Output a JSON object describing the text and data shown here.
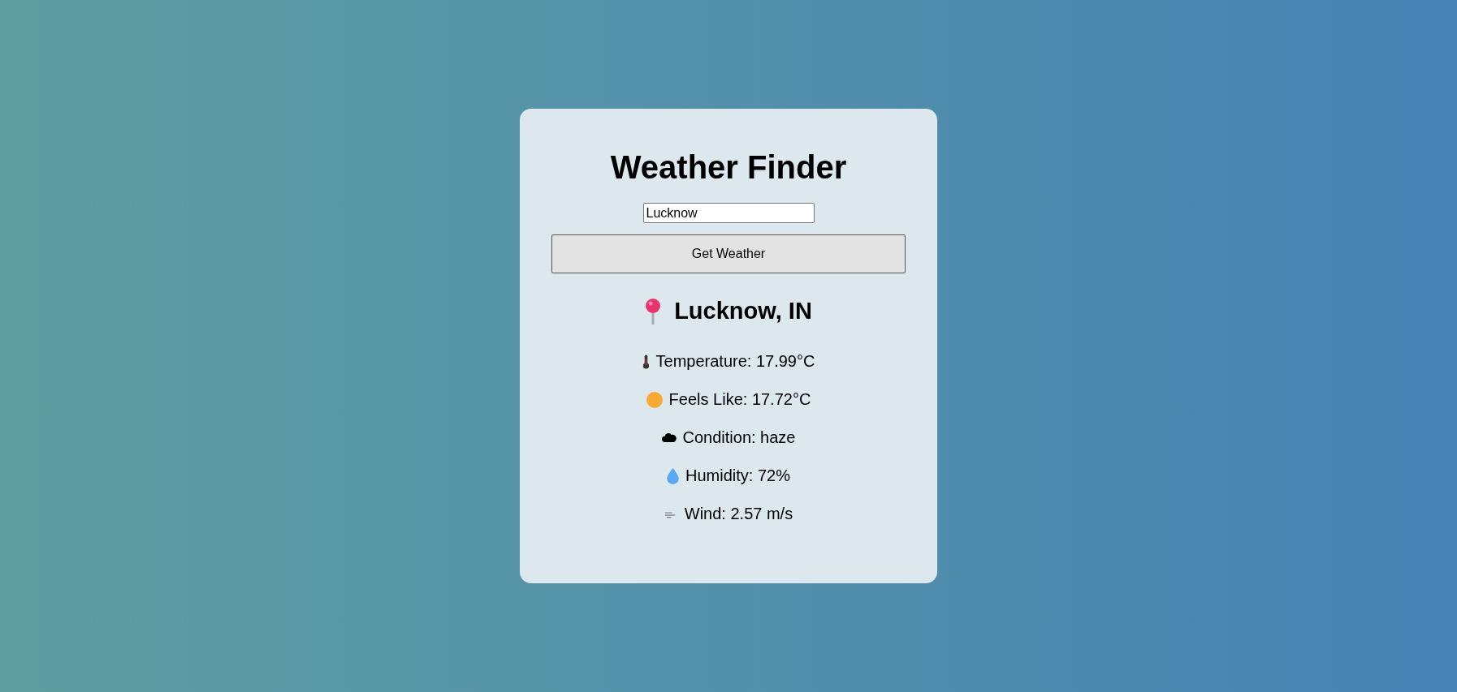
{
  "title": "Weather Finder",
  "search": {
    "value": "Lucknow"
  },
  "button": {
    "label": "Get Weather"
  },
  "location": {
    "name": "Lucknow, IN"
  },
  "details": [
    {
      "kind": "temperature",
      "text": "Temperature: 17.99°C"
    },
    {
      "kind": "feels",
      "text": "Feels Like: 17.72°C"
    },
    {
      "kind": "condition",
      "text": "Condition: haze"
    },
    {
      "kind": "humidity",
      "text": "Humidity: 72%"
    },
    {
      "kind": "wind",
      "text": "Wind: 2.57 m/s"
    }
  ]
}
